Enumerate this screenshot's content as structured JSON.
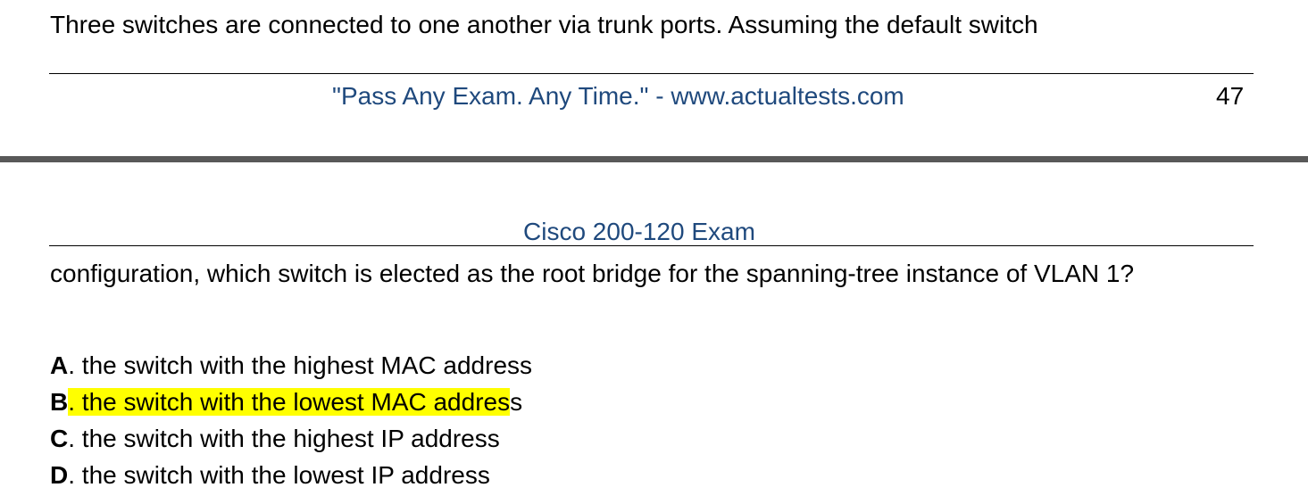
{
  "prev_page": {
    "text": "Three switches are connected to one another via trunk ports. Assuming the default switch"
  },
  "footer": {
    "slogan": "\"Pass Any Exam. Any Time.\" - www.actualtests.com",
    "page_number": "47"
  },
  "header": {
    "title": "Cisco 200-120 Exam"
  },
  "next_page": {
    "text": "configuration, which switch is elected as the root bridge for the spanning-tree instance of VLAN 1?"
  },
  "options": [
    {
      "letter": "A",
      "text": "the switch with the highest MAC address"
    },
    {
      "letter": "B",
      "text_highlighted": ". the switch with the lowest MAC addres",
      "text_rest": "s"
    },
    {
      "letter": "C",
      "text": "the switch with the highest IP address"
    },
    {
      "letter": "D",
      "text": "the switch with the lowest IP address"
    }
  ],
  "colors": {
    "header_footer_text": "#1f497d",
    "highlight": "#ffff00",
    "page_separator": "#595959"
  }
}
